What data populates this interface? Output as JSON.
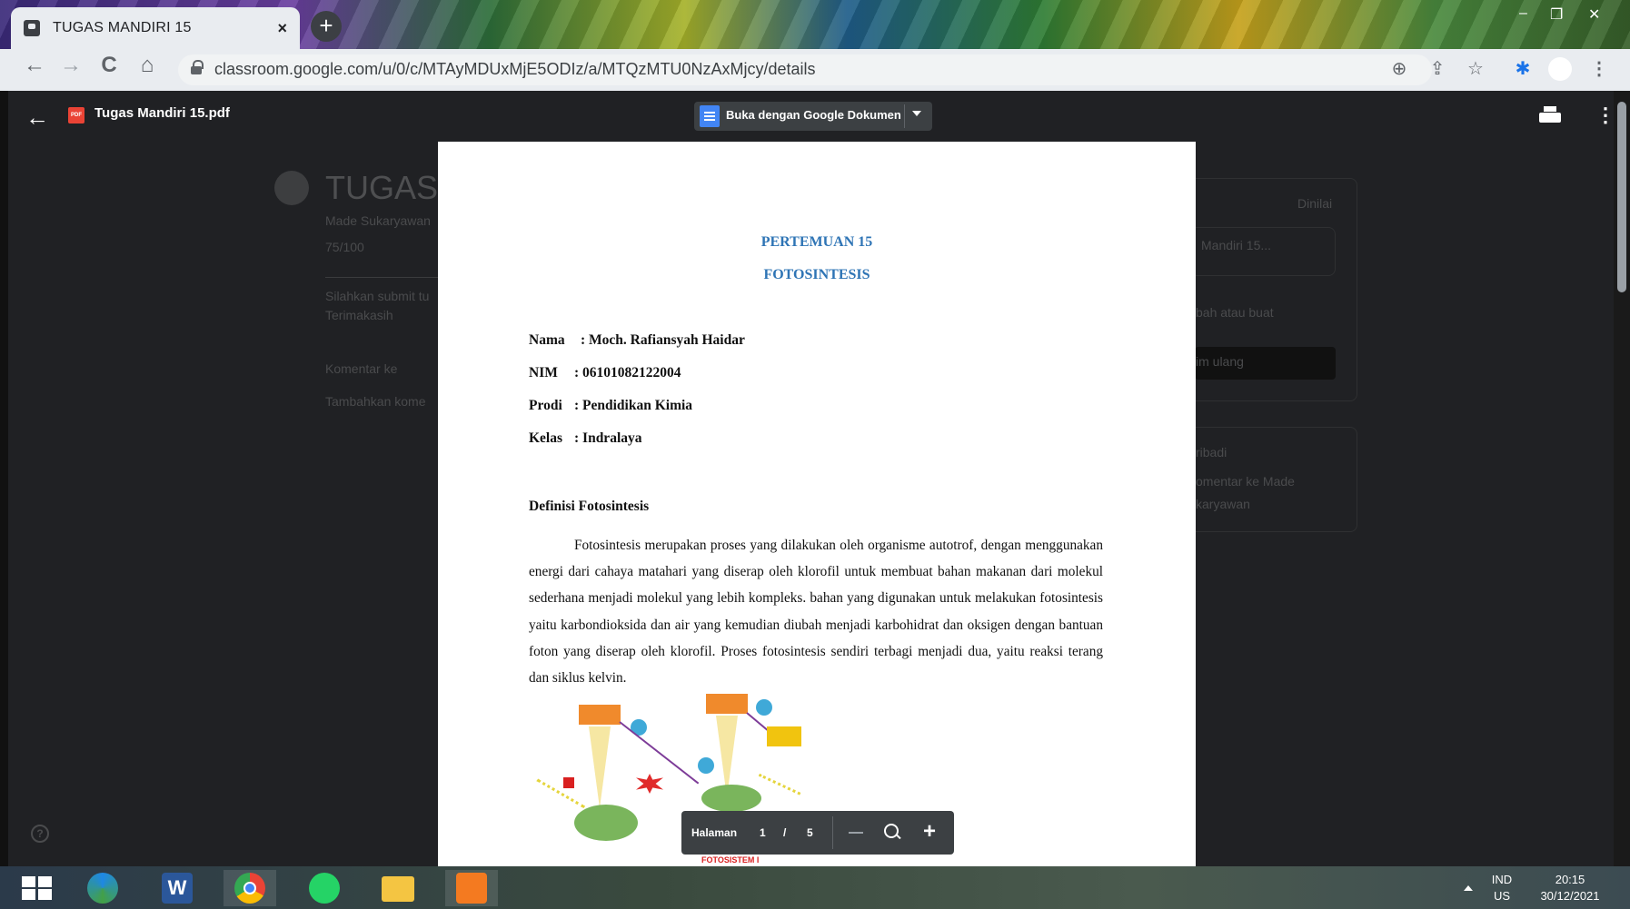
{
  "browser": {
    "tab_title": "TUGAS MANDIRI 15",
    "tab_close": "×",
    "new_tab": "+",
    "url": "classroom.google.com/u/0/c/MTAyMDUxMjE5ODIz/a/MTQzMTU0NzAxMjcy/details",
    "nav": {
      "back": "←",
      "forward": "→",
      "reload": "C",
      "home": "⌂"
    },
    "toolbar_icons": {
      "zoom": "⊕",
      "share": "⇪",
      "star": "☆",
      "extensions": "✱",
      "menu": "⋮"
    },
    "window_controls": {
      "minimize": "–",
      "restore": "❐",
      "close": "✕"
    }
  },
  "viewer": {
    "back": "←",
    "file_badge": "PDF",
    "file_name": "Tugas Mandiri 15.pdf",
    "open_with": "Buka dengan Google Dokumen",
    "more": "⋮"
  },
  "background_page": {
    "title": "TUGAS M",
    "author": "Made Sukaryawan",
    "points": "75/100",
    "instruction_1": "Silahkan submit tu",
    "instruction_2": "Terimakasih",
    "class_comment": "Komentar ke",
    "add_comment": "Tambahkan kome",
    "right_label": "Dinilai",
    "attachment": "Mandiri 15...",
    "add_or_create": "bah atau buat",
    "resubmit": "im ulang",
    "private": "ribadi",
    "private_comment_1": "omentar ke Made",
    "private_comment_2": "karyawan",
    "help": "?"
  },
  "pdf": {
    "heading1": "PERTEMUAN 15",
    "heading2": "FOTOSINTESIS",
    "fields": [
      {
        "label": "Nama",
        "value": ": Moch. Rafiansyah Haidar"
      },
      {
        "label": "NIM",
        "value": ": 06101082122004"
      },
      {
        "label": "Prodi",
        "value": ": Pendidikan Kimia"
      },
      {
        "label": "Kelas",
        "value": ": Indralaya"
      }
    ],
    "section_heading": "Definisi Fotosintesis",
    "paragraph": "Fotosintesis merupakan proses yang dilakukan oleh organisme autotrof, dengan menggunakan energi dari cahaya matahari yang diserap oleh klorofil untuk membuat bahan makanan dari molekul sederhana menjadi molekul yang lebih kompleks. bahan yang digunakan untuk melakukan fotosintesis yaitu karbondioksida dan air yang kemudian diubah menjadi karbohidrat dan oksigen dengan bantuan foton yang diserap oleh klorofil. Proses fotosintesis sendiri terbagi menjadi dua, yaitu reaksi terang dan siklus kelvin.",
    "diagram_caption": "FOTOSISTEM I"
  },
  "page_toolbar": {
    "label": "Halaman",
    "current": "1",
    "separator": "/",
    "total": "5",
    "zoom_in": "+"
  },
  "taskbar": {
    "apps": [
      "windows-start",
      "edge",
      "word",
      "chrome",
      "whatsapp",
      "file-explorer",
      "pdf-app"
    ],
    "word_letter": "W",
    "lang_top": "IND",
    "lang_bottom": "US",
    "time": "20:15",
    "date": "30/12/2021"
  },
  "colors": {
    "pdf_heading": "#2e74b5",
    "viewer_bg": "#202124",
    "viewer_button": "#3c4043",
    "docs_blue": "#4285f4",
    "pdf_red": "#ea4335"
  }
}
